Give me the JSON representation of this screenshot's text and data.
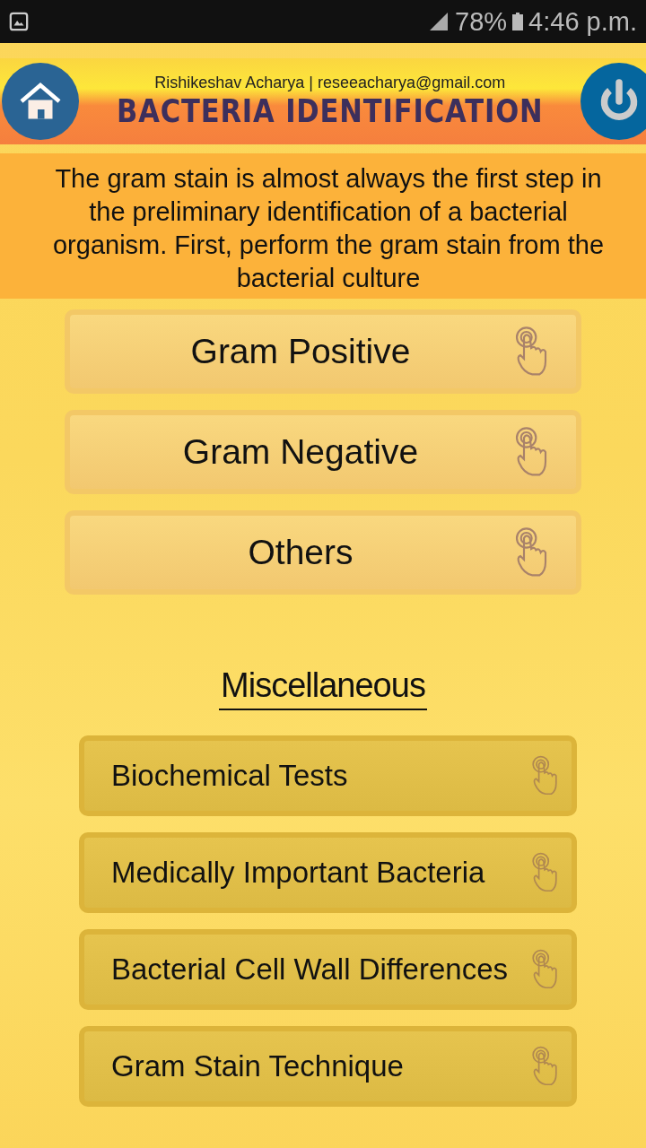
{
  "status_bar": {
    "battery": "78%",
    "time": "4:46 p.m."
  },
  "header": {
    "author": "Rishikeshav Acharya | reseeacharya@gmail.com",
    "title": "BACTERIA IDENTIFICATION"
  },
  "intro": "The gram stain is almost always the first step in the preliminary identification of a bacterial organism. First, perform the gram stain from the bacterial culture",
  "main_buttons": [
    {
      "label": "Gram Positive"
    },
    {
      "label": "Gram Negative"
    },
    {
      "label": "Others"
    }
  ],
  "misc_heading": "Miscellaneous",
  "misc_buttons": [
    {
      "label": "Biochemical Tests"
    },
    {
      "label": "Medically Important Bacteria"
    },
    {
      "label": "Bacterial Cell Wall Differences"
    },
    {
      "label": "Gram Stain Technique"
    }
  ]
}
